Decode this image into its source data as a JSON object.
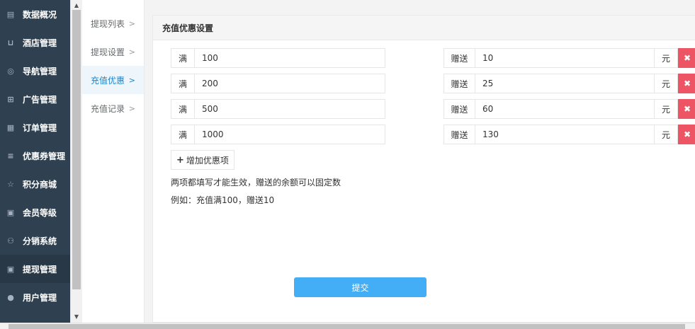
{
  "sidebar": {
    "items": [
      {
        "icon": "newspaper-icon",
        "glyph": "▤",
        "label": "数据概况"
      },
      {
        "icon": "cart-icon",
        "glyph": "⊔",
        "label": "酒店管理"
      },
      {
        "icon": "compass-icon",
        "glyph": "◎",
        "label": "导航管理"
      },
      {
        "icon": "gift-icon",
        "glyph": "⊞",
        "label": "广告管理"
      },
      {
        "icon": "server-icon",
        "glyph": "▦",
        "label": "订单管理"
      },
      {
        "icon": "list-icon",
        "glyph": "≡",
        "label": "优惠券管理"
      },
      {
        "icon": "star-icon",
        "glyph": "☆",
        "label": "积分商城"
      },
      {
        "icon": "money-icon",
        "glyph": "▣",
        "label": "会员等级"
      },
      {
        "icon": "users-icon",
        "glyph": "⚇",
        "label": "分销系统"
      },
      {
        "icon": "money-icon",
        "glyph": "▣",
        "label": "提现管理",
        "active": true
      },
      {
        "icon": "user-icon",
        "glyph": "●",
        "label": "用户管理"
      }
    ]
  },
  "submenu": {
    "items": [
      {
        "label": "提现列表"
      },
      {
        "label": "提现设置"
      },
      {
        "label": "充值优惠",
        "active": true
      },
      {
        "label": "充值记录"
      }
    ],
    "chevron": ">"
  },
  "panel": {
    "title": "充值优惠设置",
    "full_label": "满",
    "gift_label": "赠送",
    "unit_label": "元",
    "delete_glyph": "✖",
    "rows": [
      {
        "full": "100",
        "gift": "10"
      },
      {
        "full": "200",
        "gift": "25"
      },
      {
        "full": "500",
        "gift": "60"
      },
      {
        "full": "1000",
        "gift": "130"
      }
    ],
    "add_label": "增加优惠项",
    "note1": "两项都填写才能生效，赠送的余额可以固定数",
    "note2": "例如：充值满100，赠送10",
    "submit_label": "提交"
  },
  "colors": {
    "sidebar_bg": "#2f4050",
    "delete": "#ed5565",
    "submit": "#43aef5",
    "active_sub": "#1c84c6"
  }
}
